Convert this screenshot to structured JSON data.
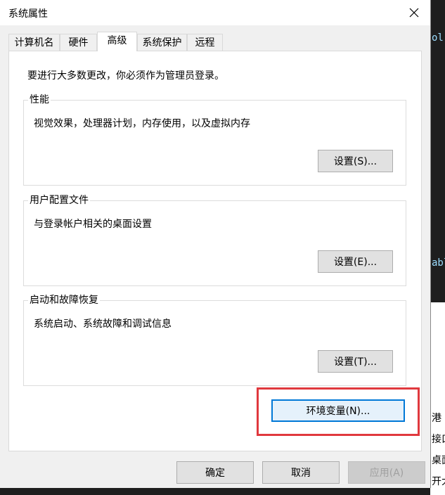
{
  "window": {
    "title": "系统属性"
  },
  "tabs": [
    {
      "label": "计算机名"
    },
    {
      "label": "硬件"
    },
    {
      "label": "高级"
    },
    {
      "label": "系统保护"
    },
    {
      "label": "远程"
    }
  ],
  "advanced": {
    "admin_note": "要进行大多数更改，你必须作为管理员登录。",
    "performance": {
      "title": "性能",
      "description": "视觉效果，处理器计划，内存使用，以及虚拟内存",
      "button": "设置(S)..."
    },
    "user_profiles": {
      "title": "用户配置文件",
      "description": "与登录帐户相关的桌面设置",
      "button": "设置(E)..."
    },
    "startup_recovery": {
      "title": "启动和故障恢复",
      "description": "系统启动、系统故障和调试信息",
      "button": "设置(T)..."
    },
    "env_button": "环境变量(N)..."
  },
  "footer": {
    "ok": "确定",
    "cancel": "取消",
    "apply": "应用(A)"
  },
  "background": {
    "code_fragments": [
      "ol",
      "abl"
    ],
    "side_text": [
      "港",
      "接口",
      "桌面",
      "开大"
    ]
  },
  "colors": {
    "highlight_border": "#e0393e",
    "focus_border": "#0078d7",
    "dialog_bg": "#f0f0f0"
  }
}
